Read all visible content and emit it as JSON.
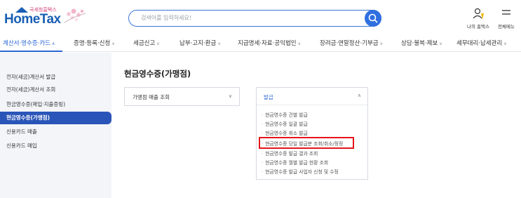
{
  "header": {
    "logo_sub": "국세청홈택스",
    "logo_main": "HomeTax",
    "search_placeholder": "검색어를 입력하세요!",
    "my_hometax_label": "나의 홈택스",
    "all_menu_label": "전체메뉴"
  },
  "gnb": {
    "items": [
      {
        "label": "계산서·영수증·카드"
      },
      {
        "label": "증명·등록·신청"
      },
      {
        "label": "세금신고"
      },
      {
        "label": "납부·고지·환급"
      },
      {
        "label": "지급명세·자료·공익법인"
      },
      {
        "label": "장려금·연말정산·기부금"
      },
      {
        "label": "상담·불복·제보"
      },
      {
        "label": "세무대리·납세관리"
      }
    ]
  },
  "lnb": {
    "items": [
      {
        "label": "전자(세금)계산서 발급"
      },
      {
        "label": "전자(세금)계산서 조회"
      },
      {
        "label": "현금영수증(매입·지출증빙)"
      },
      {
        "label": "현금영수증(가맹점)"
      },
      {
        "label": "신용카드 매출"
      },
      {
        "label": "신용카드 매입"
      }
    ]
  },
  "content": {
    "page_title": "현금영수증(가맹점)",
    "acc_sales": {
      "label": "가맹점 매출 조회"
    },
    "acc_issue": {
      "label": "발급",
      "items": [
        {
          "label": "현금영수증 건별 발급"
        },
        {
          "label": "현금영수증 일괄 발급"
        },
        {
          "label": "현금영수증 취소 발급"
        },
        {
          "label": "현금영수증 당일 발급분 조회/취소/정정"
        },
        {
          "label": "현금영수증 발급 결과 조회"
        },
        {
          "label": "현금영수증 월별 발급 현황 조회"
        },
        {
          "label": "현금영수증 발급 사업자 신청 및 수정"
        }
      ]
    }
  },
  "colors": {
    "accent": "#2a66d6",
    "nav_active_bg": "#2a55b8",
    "highlight": "#e4161b"
  }
}
